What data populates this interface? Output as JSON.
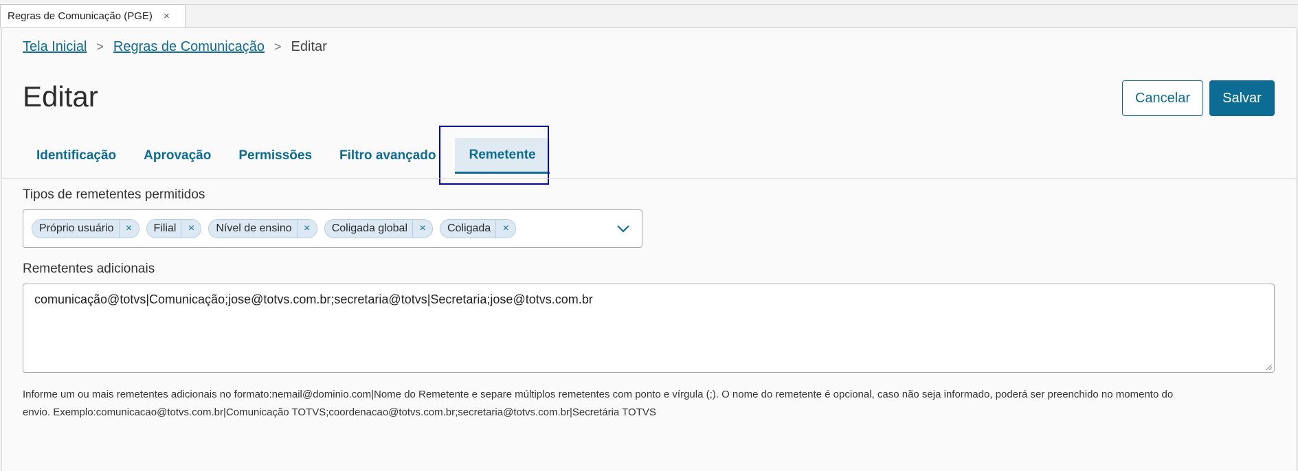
{
  "window_tab": {
    "title": "Regras de Comunicação (PGE)",
    "close": "×"
  },
  "breadcrumb": {
    "items": [
      "Tela Inicial",
      "Regras de Comunicação"
    ],
    "current": "Editar",
    "separator": ">"
  },
  "page": {
    "title": "Editar"
  },
  "actions": {
    "cancel": "Cancelar",
    "save": "Salvar"
  },
  "tabs": [
    {
      "label": "Identificação"
    },
    {
      "label": "Aprovação"
    },
    {
      "label": "Permissões"
    },
    {
      "label": "Filtro avançado"
    },
    {
      "label": "Remetente",
      "active": true
    }
  ],
  "sender_types": {
    "label": "Tipos de remetentes permitidos",
    "chips": [
      "Próprio usuário",
      "Filial",
      "Nível de ensino",
      "Coligada global",
      "Coligada"
    ],
    "chip_remove": "×"
  },
  "additional_senders": {
    "label": "Remetentes adicionais",
    "value": "comunicação@totvs|Comunicação;jose@totvs.com.br;secretaria@totvs|Secretaria;jose@totvs.com.br",
    "helper_line1": "Informe um ou mais remetentes adicionais no formato:nemail@dominio.com|Nome do Remetente e separe múltiplos remetentes com ponto e vírgula (;). O nome do remetente é opcional, caso não seja informado, poderá ser preenchido no momento do",
    "helper_line2": "envio. Exemplo:comunicacao@totvs.com.br|Comunicação TOTVS;coordenacao@totvs.com.br;secretaria@totvs.com.br|Secretária TOTVS"
  },
  "colors": {
    "accent": "#0c6c94",
    "chip_bg": "#dce9f4",
    "highlight": "#0000cc"
  },
  "icons": {
    "dropdown": "chevron-down-icon",
    "remove": "close-icon"
  }
}
